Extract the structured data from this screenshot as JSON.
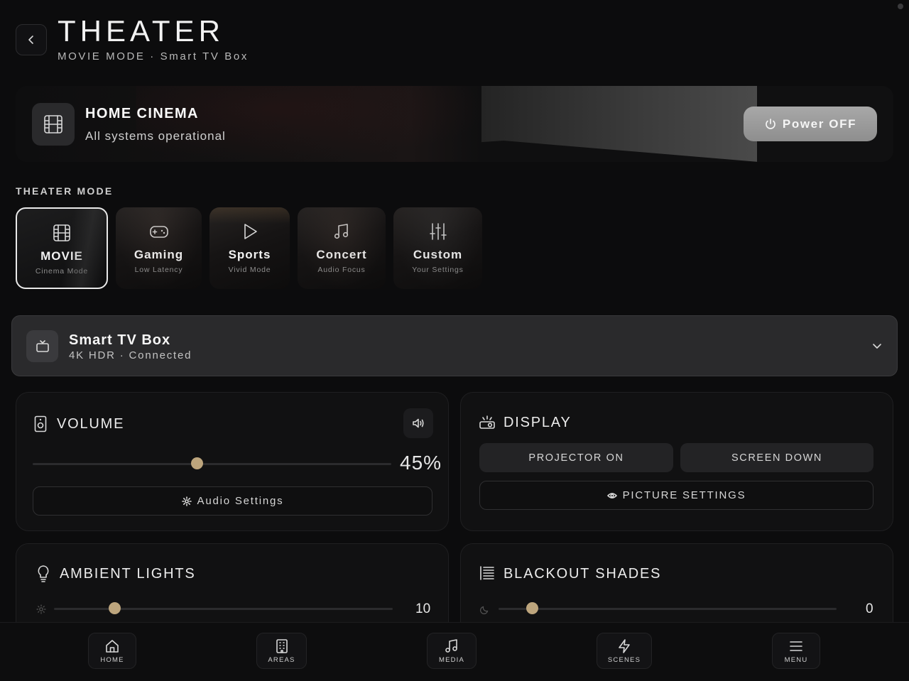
{
  "header": {
    "title": "THEATER",
    "subtitle": "MOVIE MODE · Smart TV Box"
  },
  "hero": {
    "title": "HOME CINEMA",
    "status": "All systems operational",
    "power_label": "Power OFF"
  },
  "theater_mode": {
    "label": "THEATER MODE",
    "modes": [
      {
        "label": "MOVIE",
        "sub": "Cinema Mode",
        "icon": "film-icon",
        "active": true
      },
      {
        "label": "Gaming",
        "sub": "Low Latency",
        "icon": "gamepad-icon",
        "active": false
      },
      {
        "label": "Sports",
        "sub": "Vivid Mode",
        "icon": "play-icon",
        "active": false
      },
      {
        "label": "Concert",
        "sub": "Audio Focus",
        "icon": "music-note-icon",
        "active": false
      },
      {
        "label": "Custom",
        "sub": "Your Settings",
        "icon": "sliders-icon",
        "active": false
      }
    ]
  },
  "source": {
    "name": "Smart TV Box",
    "status": "4K HDR · Connected"
  },
  "volume": {
    "title": "VOLUME",
    "value": 45,
    "value_text": "45%",
    "settings_label": "Audio Settings"
  },
  "display": {
    "title": "DISPLAY",
    "projector_label": "PROJECTOR ON",
    "screen_label": "SCREEN DOWN",
    "picture_label": "PICTURE SETTINGS"
  },
  "ambient_lights": {
    "title": "AMBIENT LIGHTS",
    "value": 10,
    "value_text": "10"
  },
  "blackout_shades": {
    "title": "BLACKOUT SHADES",
    "value": 0,
    "value_text": "0"
  },
  "nav": {
    "home": "HOME",
    "areas": "AREAS",
    "media": "MEDIA",
    "scenes": "SCENES",
    "menu": "MENU"
  },
  "colors": {
    "accent": "#bda57d",
    "background": "#0c0c0d",
    "panel": "#111112"
  }
}
